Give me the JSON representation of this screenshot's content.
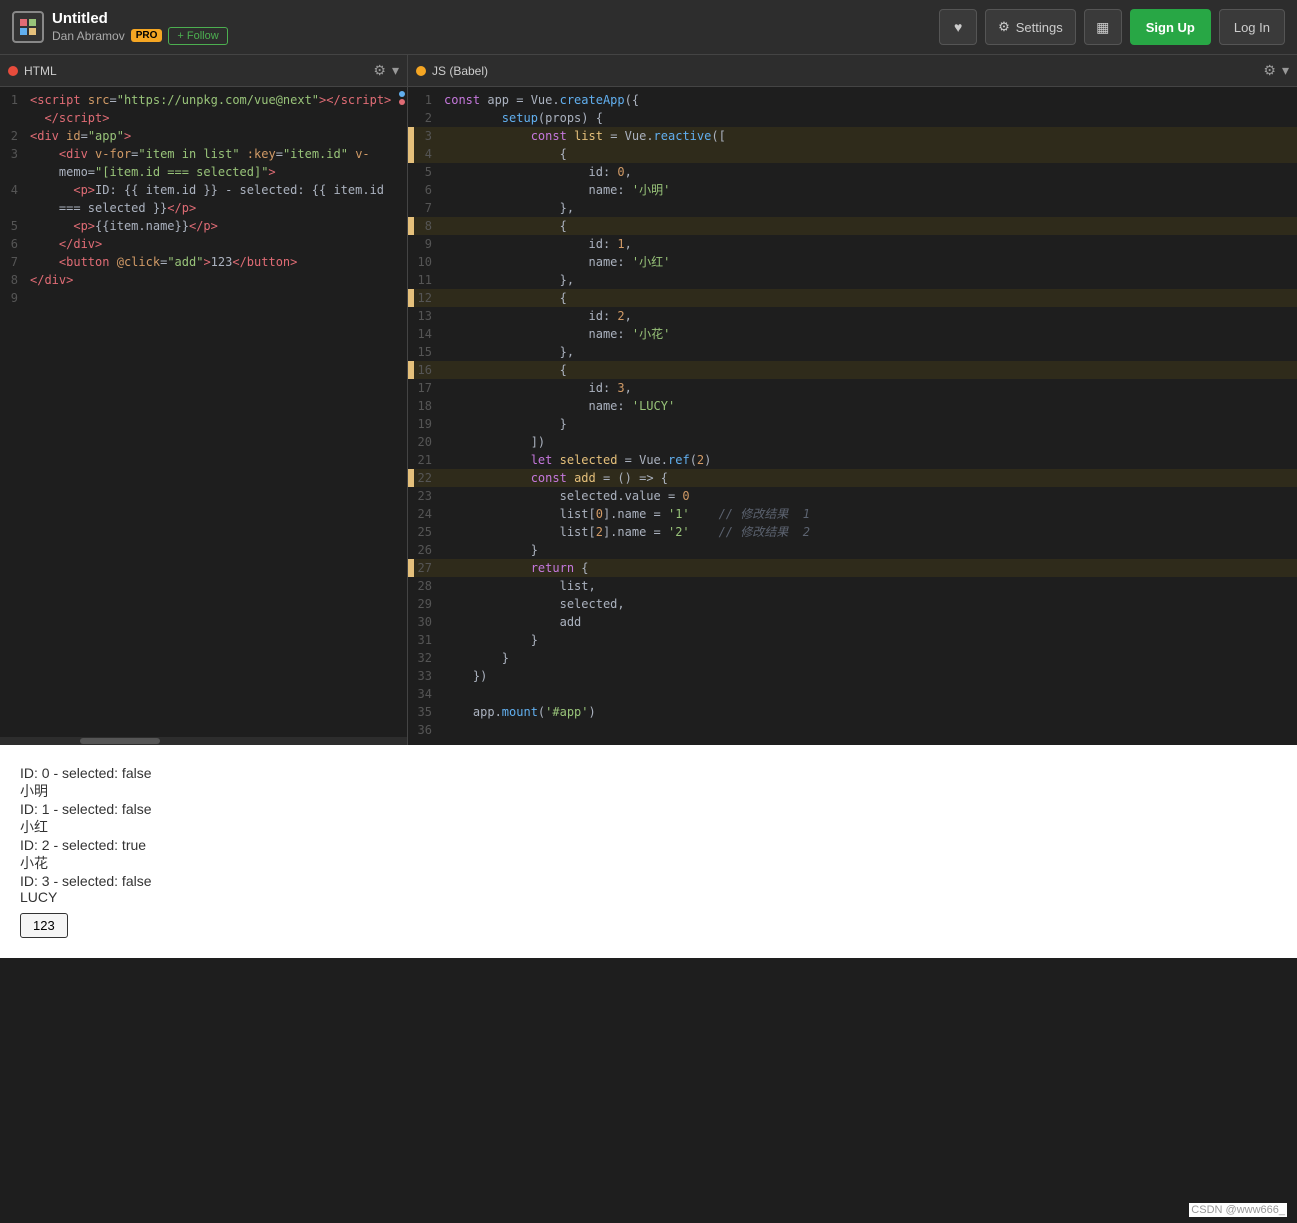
{
  "header": {
    "title": "Untitled",
    "author": "Dan Abramov",
    "pro_label": "PRO",
    "follow_label": "+ Follow",
    "heart_icon": "♥",
    "settings_icon": "⚙",
    "settings_label": "Settings",
    "grid_icon": "▦",
    "signup_label": "Sign Up",
    "login_label": "Log In"
  },
  "panels": {
    "html": {
      "title": "HTML",
      "lang_dot": "html"
    },
    "js": {
      "title": "JS (Babel)",
      "lang_dot": "js"
    }
  },
  "html_code": [
    {
      "num": 1,
      "text": "<script src=\"https://unpkg.com/vue@next\"><\\/script>",
      "modified": false
    },
    {
      "num": "",
      "text": "  <\\/script>",
      "modified": false
    },
    {
      "num": 2,
      "text": "<div id=\"app\">",
      "modified": false
    },
    {
      "num": 3,
      "text": "    <div v-for=\"item in list\" :key=\"item.id\" v-memo=\"[item.id === selected]\">",
      "modified": false
    },
    {
      "num": "",
      "text": "    memo=\"[item.id === selected]\">",
      "modified": false
    },
    {
      "num": 4,
      "text": "      <p>ID: {{ item.id }} - selected: {{ item.id",
      "modified": false
    },
    {
      "num": "",
      "text": "    === selected }}</p>",
      "modified": false
    },
    {
      "num": 5,
      "text": "      <p>{{item.name}}</p>",
      "modified": false
    },
    {
      "num": 6,
      "text": "    </div>",
      "modified": false
    },
    {
      "num": 7,
      "text": "    <button @click=\"add\">123</button>",
      "modified": false
    },
    {
      "num": 8,
      "text": "</div>",
      "modified": false
    },
    {
      "num": 9,
      "text": "",
      "modified": false
    }
  ],
  "js_code": [
    {
      "num": 1,
      "modified": false,
      "html": "<span class='kw'>const</span> app = Vue.<span class='fn'>createApp</span>({"
    },
    {
      "num": 2,
      "modified": false,
      "html": "        <span class='fn'>setup</span>(props) {"
    },
    {
      "num": 3,
      "modified": true,
      "html": "            <span class='kw'>const</span> <span class='const-name'>list</span> = Vue.<span class='fn'>reactive</span>(["
    },
    {
      "num": 4,
      "modified": true,
      "html": "                {"
    },
    {
      "num": 5,
      "modified": false,
      "html": "                    id: <span class='num'>0</span>,"
    },
    {
      "num": 6,
      "modified": false,
      "html": "                    name: <span class='str'>'小明'</span>"
    },
    {
      "num": 7,
      "modified": false,
      "html": "                },"
    },
    {
      "num": 8,
      "modified": true,
      "html": "                {"
    },
    {
      "num": 9,
      "modified": false,
      "html": "                    id: <span class='num'>1</span>,"
    },
    {
      "num": 10,
      "modified": false,
      "html": "                    name: <span class='str'>'小红'</span>"
    },
    {
      "num": 11,
      "modified": false,
      "html": "                },"
    },
    {
      "num": 12,
      "modified": true,
      "html": "                {"
    },
    {
      "num": 13,
      "modified": false,
      "html": "                    id: <span class='num'>2</span>,"
    },
    {
      "num": 14,
      "modified": false,
      "html": "                    name: <span class='str'>'小花'</span>"
    },
    {
      "num": 15,
      "modified": false,
      "html": "                },"
    },
    {
      "num": 16,
      "modified": true,
      "html": "                {"
    },
    {
      "num": 17,
      "modified": false,
      "html": "                    id: <span class='num'>3</span>,"
    },
    {
      "num": 18,
      "modified": false,
      "html": "                    name: <span class='str'>'LUCY'</span>"
    },
    {
      "num": 19,
      "modified": false,
      "html": "                }"
    },
    {
      "num": 20,
      "modified": false,
      "html": "            ])"
    },
    {
      "num": 21,
      "modified": false,
      "html": "            <span class='kw'>let</span> <span class='const-name'>selected</span> = Vue.<span class='fn'>ref</span>(<span class='num'>2</span>)"
    },
    {
      "num": 22,
      "modified": true,
      "html": "            <span class='kw'>const</span> <span class='const-name'>add</span> = () =&gt; {"
    },
    {
      "num": 23,
      "modified": false,
      "html": "                selected.value = <span class='num'>0</span>"
    },
    {
      "num": 24,
      "modified": false,
      "html": "                list[<span class='num'>0</span>].name = <span class='str'>'1'</span>    <span class='cmt'>// 修改结果  1</span>"
    },
    {
      "num": 25,
      "modified": false,
      "html": "                list[<span class='num'>2</span>].name = <span class='str'>'2'</span>    <span class='cmt'>// 修改结果  2</span>"
    },
    {
      "num": 26,
      "modified": false,
      "html": "            }"
    },
    {
      "num": 27,
      "modified": true,
      "html": "            <span class='kw'>return</span> {"
    },
    {
      "num": 28,
      "modified": false,
      "html": "                list,"
    },
    {
      "num": 29,
      "modified": false,
      "html": "                selected,"
    },
    {
      "num": 30,
      "modified": false,
      "html": "                add"
    },
    {
      "num": 31,
      "modified": false,
      "html": "            }"
    },
    {
      "num": 32,
      "modified": false,
      "html": "        }"
    },
    {
      "num": 33,
      "modified": false,
      "html": "    })"
    },
    {
      "num": 34,
      "modified": false,
      "html": ""
    },
    {
      "num": 35,
      "modified": false,
      "html": "    app.<span class='fn'>mount</span>(<span class='str'>'#app'</span>)"
    },
    {
      "num": 36,
      "modified": false,
      "html": ""
    }
  ],
  "preview": {
    "items": [
      {
        "id_text": "ID: 0 - selected: false",
        "name": "小明"
      },
      {
        "id_text": "ID: 1 - selected: false",
        "name": "小红"
      },
      {
        "id_text": "ID: 2 - selected: true",
        "name": "小花"
      },
      {
        "id_text": "ID: 3 - selected: false",
        "name": "LUCY"
      }
    ],
    "button_label": "123"
  },
  "watermark": "CSDN @www666_"
}
